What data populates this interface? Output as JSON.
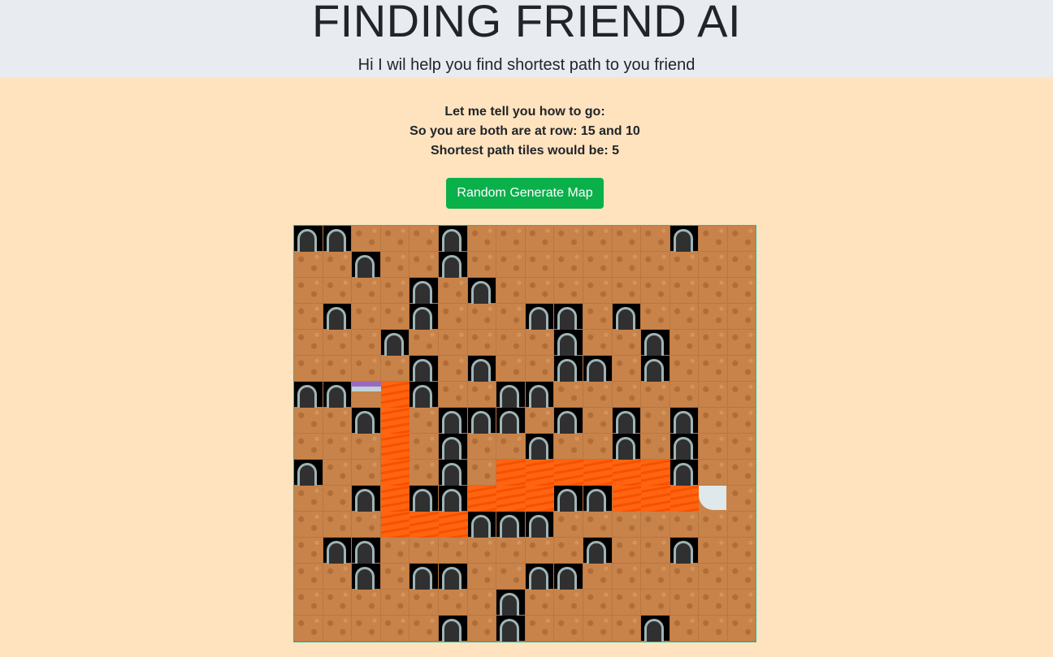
{
  "header": {
    "title": "FINDING FRIEND AI",
    "subtitle": "Hi I wil help you find shortest path to you friend"
  },
  "info": {
    "line1": "Let me tell you how to go:",
    "line2": "So you are both are at row: 15 and 10",
    "line3": "Shortest path tiles would be: 5"
  },
  "controls": {
    "random_button": "Random Generate Map"
  },
  "legend_colors": {
    "dirt": "#c8834a",
    "path": "#ff5a00",
    "button": "#0ab04a",
    "background": "#ffe3bf"
  },
  "map": {
    "rows": [
      "DD...D.......D......",
      "..D..D..............",
      "....D.D.............",
      ".D..D...DD.D........",
      "...D.....D..D.......",
      "....D.D..DD.D.......",
      "DDSPD..DD...........",
      "..DP.DDD.D.D.D......",
      "...P.D..D..D.D......",
      "D..P.D.PPPPPPD......",
      "..DPDDPPPDDPPPF.....",
      "...PPPDDD...........",
      ".DD.......D..D......",
      "..D.DD..DD..........",
      ".......D............",
      ".....D.D....D......."
    ],
    "legend": "D=door, .=dirt, P=path, S=start, F=friend"
  }
}
